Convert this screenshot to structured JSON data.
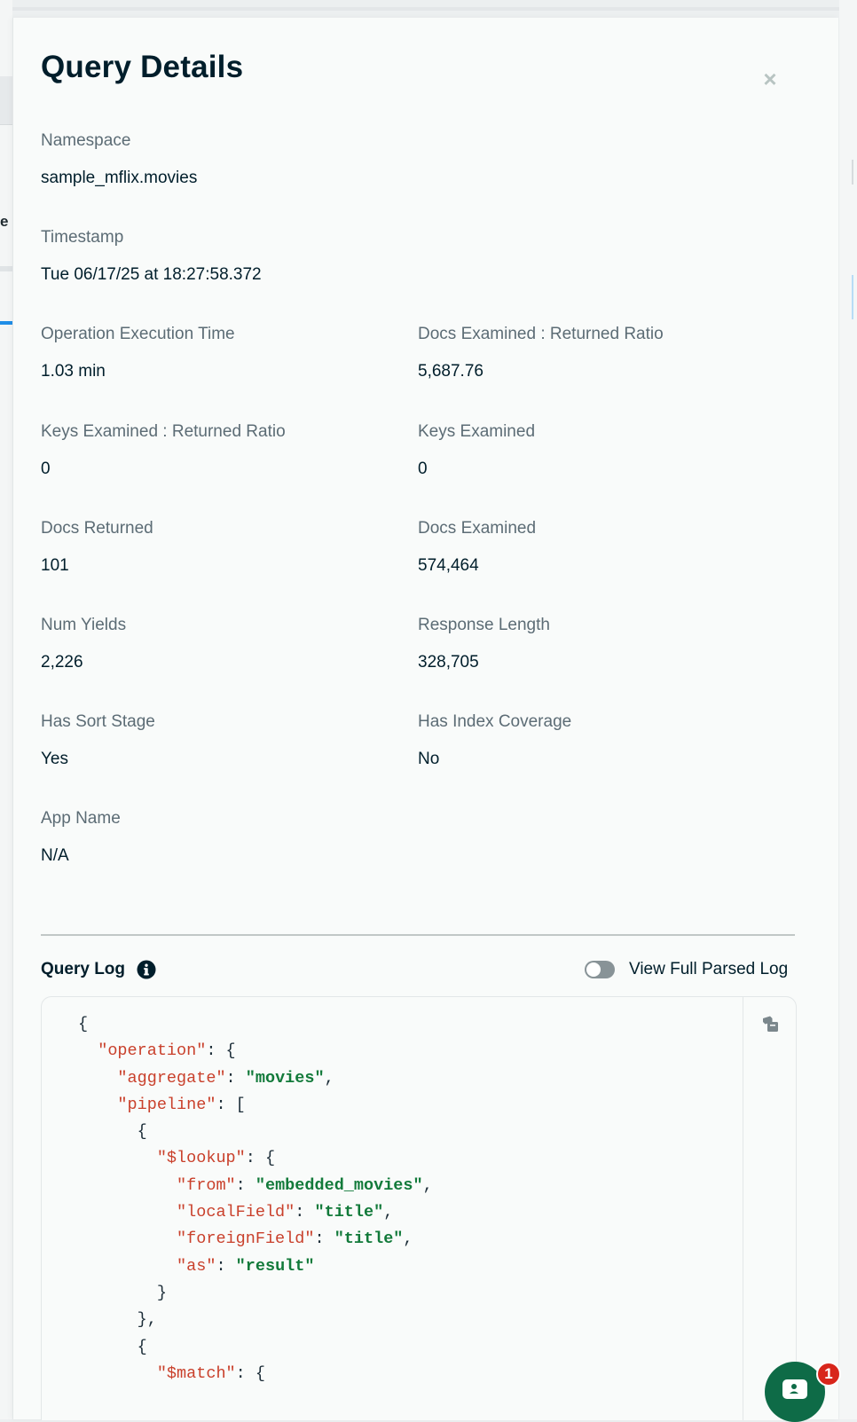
{
  "drawer": {
    "title": "Query Details",
    "close_icon": "×"
  },
  "fields": {
    "namespace": {
      "label": "Namespace",
      "value": "sample_mflix.movies"
    },
    "timestamp": {
      "label": "Timestamp",
      "value": "Tue 06/17/25 at 18:27:58.372"
    },
    "exec_time": {
      "label": "Operation Execution Time",
      "value": "1.03 min"
    },
    "docs_ratio": {
      "label": "Docs Examined : Returned Ratio",
      "value": "5,687.76"
    },
    "keys_ratio": {
      "label": "Keys Examined : Returned Ratio",
      "value": "0"
    },
    "keys_examined": {
      "label": "Keys Examined",
      "value": "0"
    },
    "docs_returned": {
      "label": "Docs Returned",
      "value": "101"
    },
    "docs_examined": {
      "label": "Docs Examined",
      "value": "574,464"
    },
    "num_yields": {
      "label": "Num Yields",
      "value": "2,226"
    },
    "response_length": {
      "label": "Response Length",
      "value": "328,705"
    },
    "has_sort": {
      "label": "Has Sort Stage",
      "value": "Yes"
    },
    "index_coverage": {
      "label": "Has Index Coverage",
      "value": "No"
    },
    "app_name": {
      "label": "App Name",
      "value": "N/A"
    }
  },
  "query_log": {
    "title": "Query Log",
    "info_icon": "info-icon",
    "toggle_label": "View Full Parsed Log",
    "toggle_on": false,
    "copy_icon": "copy-icon",
    "lines": [
      {
        "indent": 0,
        "key": "",
        "value": "",
        "text": "{"
      },
      {
        "indent": 1,
        "key": "\"operation\"",
        "value": "",
        "text": ": {"
      },
      {
        "indent": 2,
        "key": "\"aggregate\"",
        "value": "\"movies\"",
        "text": ","
      },
      {
        "indent": 2,
        "key": "\"pipeline\"",
        "value": "",
        "text": ": ["
      },
      {
        "indent": 3,
        "key": "",
        "value": "",
        "text": "{"
      },
      {
        "indent": 4,
        "key": "\"$lookup\"",
        "value": "",
        "text": ": {"
      },
      {
        "indent": 5,
        "key": "\"from\"",
        "value": "\"embedded_movies\"",
        "text": ","
      },
      {
        "indent": 5,
        "key": "\"localField\"",
        "value": "\"title\"",
        "text": ","
      },
      {
        "indent": 5,
        "key": "\"foreignField\"",
        "value": "\"title\"",
        "text": ","
      },
      {
        "indent": 5,
        "key": "\"as\"",
        "value": "\"result\"",
        "text": ""
      },
      {
        "indent": 4,
        "key": "",
        "value": "",
        "text": "}"
      },
      {
        "indent": 3,
        "key": "",
        "value": "",
        "text": "},"
      },
      {
        "indent": 3,
        "key": "",
        "value": "",
        "text": "{"
      },
      {
        "indent": 4,
        "key": "\"$match\"",
        "value": "",
        "text": ": {"
      }
    ]
  },
  "chat": {
    "icon": "chat-icon",
    "badge": "1",
    "accent": "#0e6b47",
    "badge_color": "#d8261b"
  },
  "colors": {
    "code_key": "#c9402b",
    "code_string": "#127a3a",
    "label": "#5c6c75",
    "text": "#001e2b"
  }
}
